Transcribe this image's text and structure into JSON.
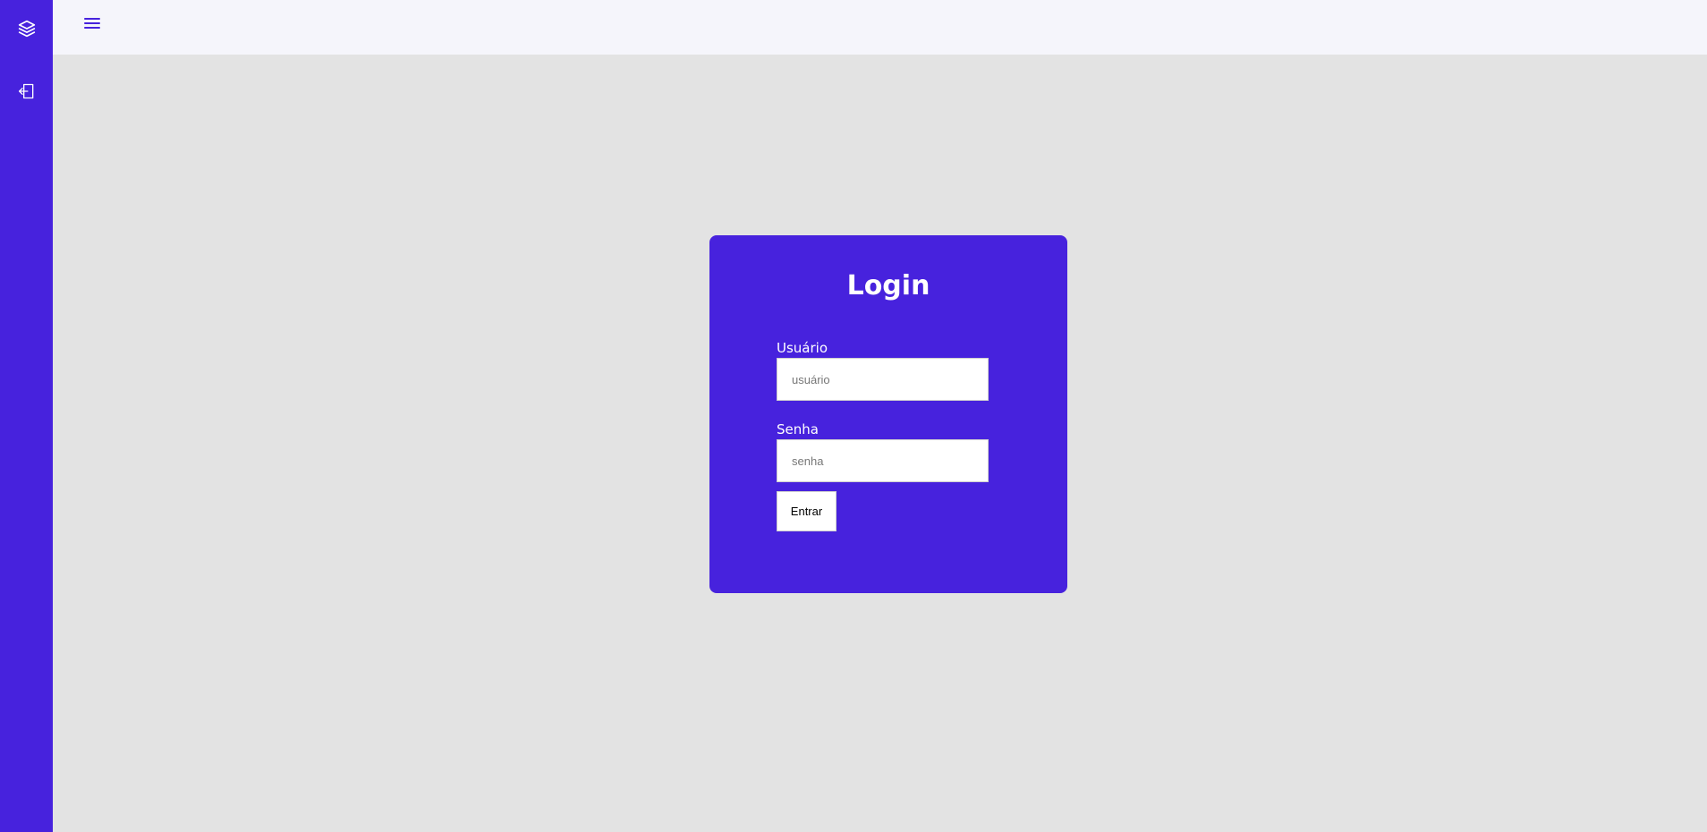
{
  "sidebar": {
    "icons": [
      "layers-icon",
      "login-icon"
    ]
  },
  "topbar": {
    "menu_icon": "hamburger-menu-icon"
  },
  "login": {
    "title": "Login",
    "username_label": "Usuário",
    "username_placeholder": "usuário",
    "username_value": "",
    "password_label": "Senha",
    "password_placeholder": "senha",
    "password_value": "",
    "submit_label": "Entrar"
  },
  "colors": {
    "accent": "#4722dd",
    "background": "#e3e3e3",
    "topbar": "#f5f5fb"
  }
}
